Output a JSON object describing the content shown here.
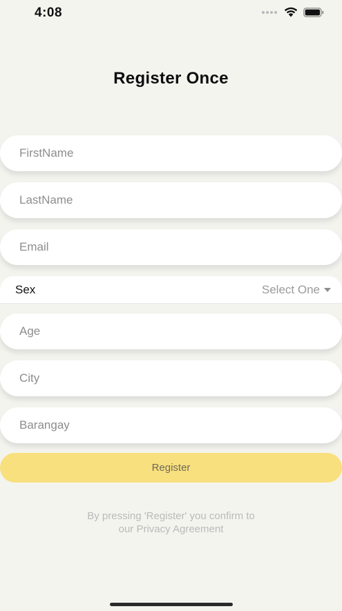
{
  "status_bar": {
    "time": "4:08",
    "icons": [
      "signal-dots-icon",
      "wifi-icon",
      "battery-icon"
    ]
  },
  "title": "Register Once",
  "form": {
    "first_name_placeholder": "FirstName",
    "last_name_placeholder": "LastName",
    "email_placeholder": "Email",
    "sex_label": "Sex",
    "sex_selected": "Select One",
    "age_placeholder": "Age",
    "city_placeholder": "City",
    "barangay_placeholder": "Barangay"
  },
  "register_button_label": "Register",
  "notice": {
    "line1": "By pressing 'Register' you confirm to",
    "line2": "our Privacy Agreement"
  },
  "colors": {
    "background": "#f4f4ef",
    "field_background": "#ffffff",
    "button_accent": "#f9e07e",
    "notice_text": "#b9b9b9"
  }
}
